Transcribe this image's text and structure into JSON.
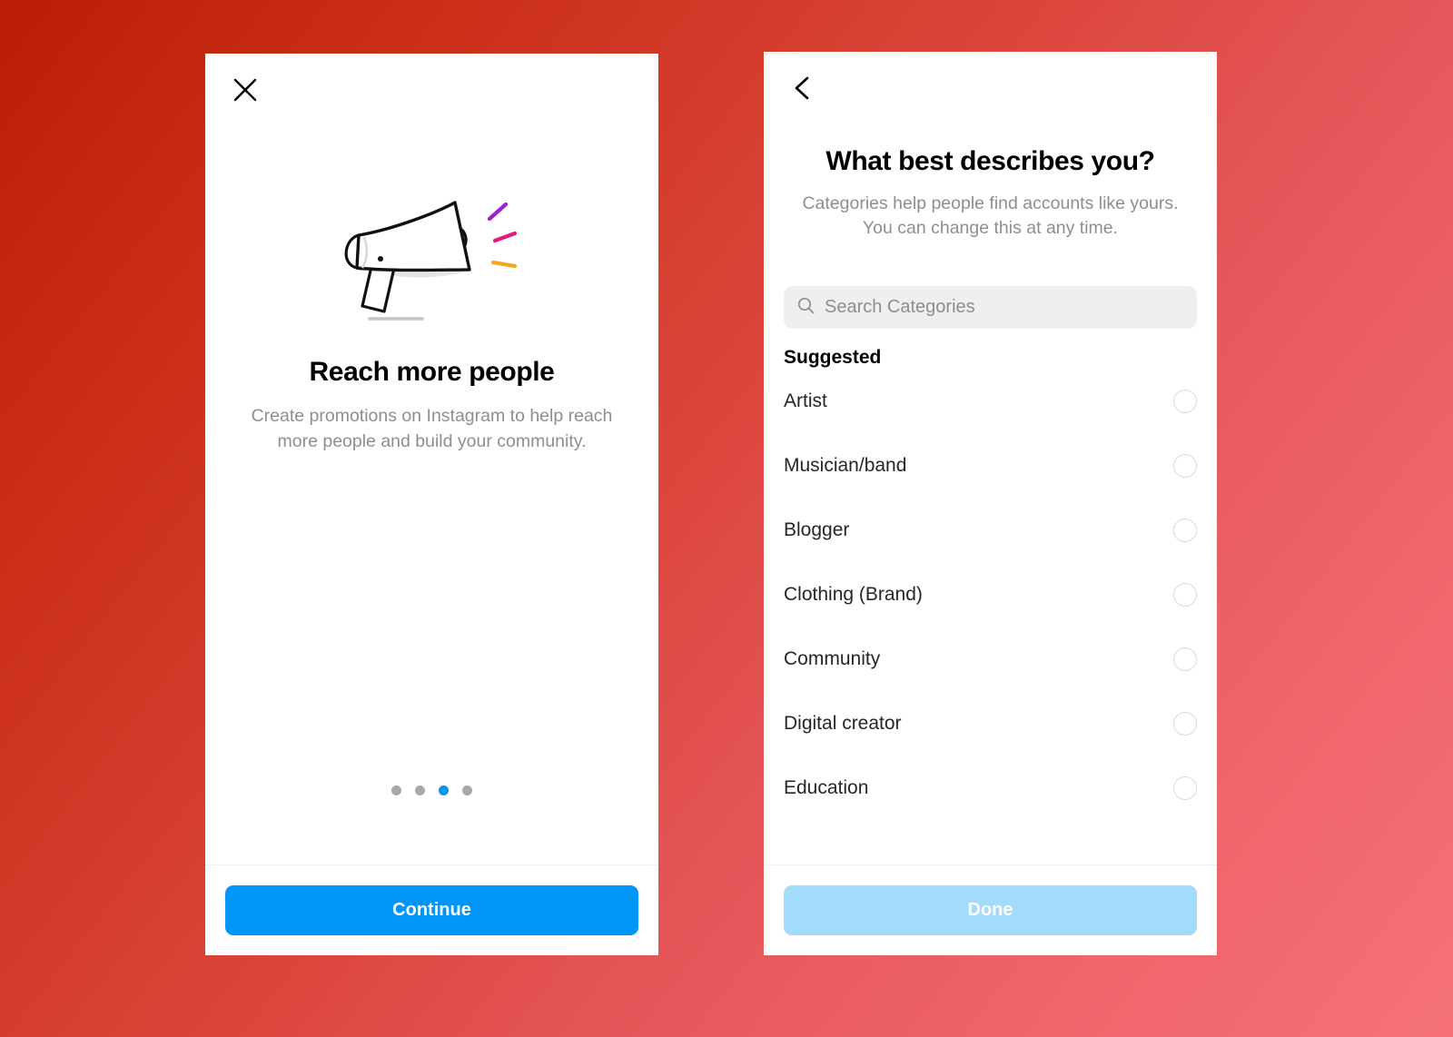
{
  "background": {
    "gradient_from": "#bb1c06",
    "gradient_to": "#f57179"
  },
  "promo_screen": {
    "close_icon": "close-icon",
    "illustration": "megaphone-illustration",
    "title": "Reach more people",
    "subtitle": "Create promotions on Instagram to help reach more people and build your community.",
    "pagination": {
      "total": 4,
      "active_index": 2
    },
    "cta_label": "Continue",
    "cta_color": "#0095f6"
  },
  "categories_screen": {
    "back_icon": "chevron-left-icon",
    "title": "What best describes you?",
    "subtitle": "Categories help people find accounts like yours. You can change this at any time.",
    "search": {
      "icon": "search-icon",
      "placeholder": "Search Categories",
      "value": ""
    },
    "group_label": "Suggested",
    "items": [
      {
        "label": "Artist",
        "selected": false
      },
      {
        "label": "Musician/band",
        "selected": false
      },
      {
        "label": "Blogger",
        "selected": false
      },
      {
        "label": "Clothing (Brand)",
        "selected": false
      },
      {
        "label": "Community",
        "selected": false
      },
      {
        "label": "Digital creator",
        "selected": false
      },
      {
        "label": "Education",
        "selected": false
      }
    ],
    "cta_label": "Done",
    "cta_enabled": false,
    "cta_color": "#a3dcfb"
  }
}
